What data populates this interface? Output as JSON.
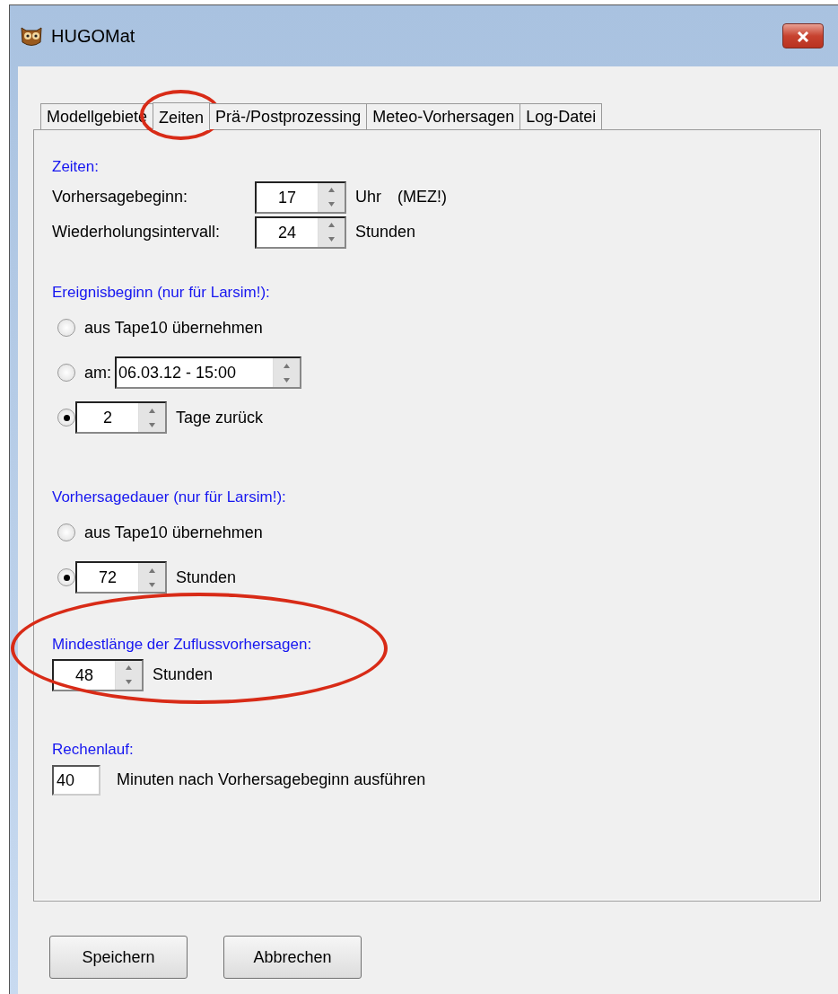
{
  "window": {
    "title": "HUGOMat"
  },
  "tabs": [
    {
      "label": "Modellgebiete",
      "selected": false,
      "highlighted": false
    },
    {
      "label": "Zeiten",
      "selected": true,
      "highlighted": true
    },
    {
      "label": "Prä-/Postprozessing",
      "selected": false,
      "highlighted": false
    },
    {
      "label": "Meteo-Vorhersagen",
      "selected": false,
      "highlighted": false
    },
    {
      "label": "Log-Datei",
      "selected": false,
      "highlighted": false
    }
  ],
  "sections": [
    {
      "heading": "Zeiten:",
      "highlighted": false,
      "rows": [
        {
          "kind": "labeled_spin",
          "label": "Vorhersagebeginn:",
          "value": "17",
          "unit": "Uhr",
          "note": "(MEZ!)"
        },
        {
          "kind": "labeled_spin",
          "label": "Wiederholungsintervall:",
          "value": "24",
          "unit": "Stunden"
        }
      ]
    },
    {
      "heading": "Ereignisbeginn (nur für Larsim!):",
      "highlighted": false,
      "rows": [
        {
          "kind": "radio",
          "selected": false,
          "label": "aus Tape10 übernehmen"
        },
        {
          "kind": "radio_date",
          "selected": false,
          "label": "am:",
          "value": "06.03.12 - 15:00"
        },
        {
          "kind": "radio_spin",
          "selected": true,
          "value": "2",
          "unit": "Tage zurück"
        }
      ]
    },
    {
      "heading": "Vorhersagedauer (nur für Larsim!):",
      "highlighted": false,
      "rows": [
        {
          "kind": "radio",
          "selected": false,
          "label": "aus Tape10 übernehmen"
        },
        {
          "kind": "radio_spin",
          "selected": true,
          "value": "72",
          "unit": "Stunden"
        }
      ]
    },
    {
      "heading": "Mindestlänge der Zuflussvorhersagen:",
      "highlighted": true,
      "rows": [
        {
          "kind": "spin",
          "value": "48",
          "unit": "Stunden"
        }
      ]
    },
    {
      "heading": "Rechenlauf:",
      "highlighted": false,
      "rows": [
        {
          "kind": "text",
          "value": "40",
          "unit": "Minuten nach Vorhersagebeginn ausführen"
        }
      ]
    }
  ],
  "buttons": [
    "Speichern",
    "Abbrechen"
  ]
}
